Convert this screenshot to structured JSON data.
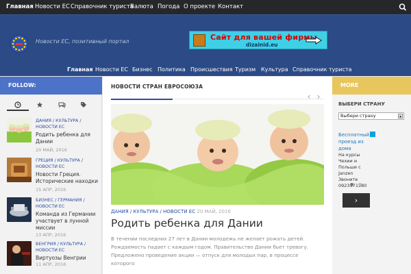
{
  "topnav": {
    "items": [
      {
        "label": "Главная"
      },
      {
        "label": "Новости ЕС"
      },
      {
        "label": "Справочник туриста"
      },
      {
        "label": "Валюта"
      },
      {
        "label": "Погода"
      },
      {
        "label": "О проекте"
      },
      {
        "label": "Контакт"
      }
    ],
    "search_icon": "search-icon"
  },
  "header": {
    "tagline": "Новости ЕС, позитивный портал",
    "banner": {
      "title": "Сайт для вашей фирмы",
      "url": "dizainid.eu"
    }
  },
  "mainnav": {
    "items": [
      {
        "label": "Главная"
      },
      {
        "label": "Новости ЕС"
      },
      {
        "label": "Бизнес"
      },
      {
        "label": "Политика"
      },
      {
        "label": "Происшествия"
      },
      {
        "label": "Туризм"
      },
      {
        "label": "Культура"
      },
      {
        "label": "Справочник туриста"
      }
    ]
  },
  "sidebar": {
    "follow": "FOLLOW:",
    "tabs": [
      {
        "icon": "clock-icon"
      },
      {
        "icon": "star-icon"
      },
      {
        "icon": "comments-icon"
      },
      {
        "icon": "tags-icon"
      }
    ],
    "posts": [
      {
        "cats": "ДАНИЯ / КУЛЬТУРА / НОВОСТИ ЕС",
        "title": "Родить ребенка для Дании",
        "date": "20 МАЙ, 2016"
      },
      {
        "cats": "ГРЕЦИЯ / КУЛЬТУРА / НОВОСТИ ЕС",
        "title": "Новости Греция. Исторические находки",
        "date": "15 АПР, 2016"
      },
      {
        "cats": "БИЗНЕС / ГЕРМАНИЯ / НОВОСТИ ЕС",
        "title": "Команда из Германии участвует в лунной миссии",
        "date": "13 АПР, 2016"
      },
      {
        "cats": "ВЕНГРИЯ / КУЛЬТУРА / НОВОСТИ ЕС",
        "title": "Виртуозы Венгрии",
        "date": "11 АПР, 2016"
      }
    ]
  },
  "main": {
    "heading": "НОВОСТИ СТРАН ЕВРОСОЮЗА",
    "article": {
      "cats": "ДАНИЯ / КУЛЬТУРА / НОВОСТИ ЕС",
      "date": "20 МАЙ, 2016",
      "title": "Родить ребенка для Дании",
      "excerpt": "В течении последних 27 лет в Дании молодежь не желает рожать детей. Рождаемость падает с каждым годом. Правительство Дании бьет тревогу. Предложено проведение акции — отпуск для молодых пар, в процессе которого"
    }
  },
  "right": {
    "more": "MORE",
    "select_label": "ВЫБЕРИ СТРАНУ",
    "select_value": "Выбери страну",
    "ad": {
      "title": "Бесплатный проезд из дома",
      "desc": "На курсы Чехии и Польши с Janzen Звоните 0923371580"
    }
  },
  "colors": {
    "topnav": "#26272b",
    "header": "#2b4a86",
    "follow": "#4d73c8",
    "more": "#e8c65e",
    "link": "#2a4ea0"
  }
}
